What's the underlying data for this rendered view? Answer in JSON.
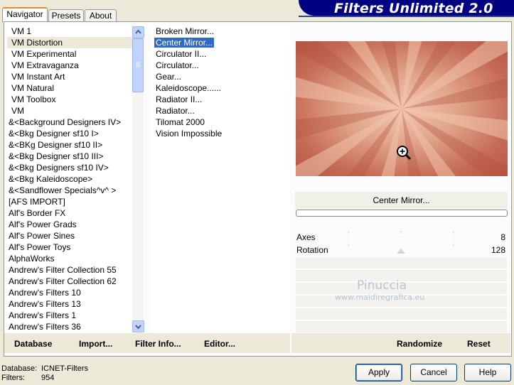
{
  "tabs": [
    {
      "label": "Navigator",
      "active": true
    },
    {
      "label": "Presets",
      "active": false
    },
    {
      "label": "About",
      "active": false
    }
  ],
  "brand": "Filters Unlimited 2.0",
  "categories": [
    "VM 1",
    "VM Distortion",
    "VM Experimental",
    "VM Extravaganza",
    "VM Instant Art",
    "VM Natural",
    "VM Toolbox",
    "VM",
    "&<Background Designers IV>",
    "&<Bkg Designer sf10 I>",
    "&<BKg Designer sf10 II>",
    "&<Bkg Designer sf10 III>",
    "&<Bkg Designers sf10 IV>",
    "&<Bkg Kaleidoscope>",
    "&<Sandflower Specials^v^ >",
    "[AFS IMPORT]",
    "Alf's Border FX",
    "Alf's Power Grads",
    "Alf's Power Sines",
    "Alf's Power Toys",
    "AlphaWorks",
    "Andrew's Filter Collection 55",
    "Andrew's Filter Collection 62",
    "Andrew's Filters 10",
    "Andrew's Filters 13",
    "Andrew's Filters 1",
    "Andrew's Filters 36"
  ],
  "selected_category_index": 1,
  "filters": [
    "Broken Mirror...",
    "Center Mirror...",
    "Circulator II...",
    "Circulator...",
    "Gear...",
    "Kaleidoscope......",
    "Radiator II...",
    "Radiator...",
    "Tilomat 2000",
    "Vision Impossible"
  ],
  "selected_filter_index": 1,
  "preview": {
    "caption": "Center Mirror...",
    "zoom_icon": "zoom-in-icon",
    "colors": {
      "dark": "#b1503e",
      "light": "#f2c4ac"
    }
  },
  "controls": [
    {
      "label": "Axes",
      "value": "8"
    },
    {
      "label": "Rotation",
      "value": "128"
    }
  ],
  "watermark": {
    "line1": "Pinuccia",
    "line2": "www.maidiregrafica.eu"
  },
  "toolbar": {
    "database": "Database",
    "import": "Import...",
    "filter_info": "Filter Info...",
    "editor": "Editor...",
    "randomize": "Randomize",
    "reset": "Reset"
  },
  "status": {
    "database_label": "Database:",
    "database_value": "ICNET-Filters",
    "filters_label": "Filters:",
    "filters_value": "954"
  },
  "buttons": {
    "apply": "Apply",
    "cancel": "Cancel",
    "help": "Help"
  }
}
